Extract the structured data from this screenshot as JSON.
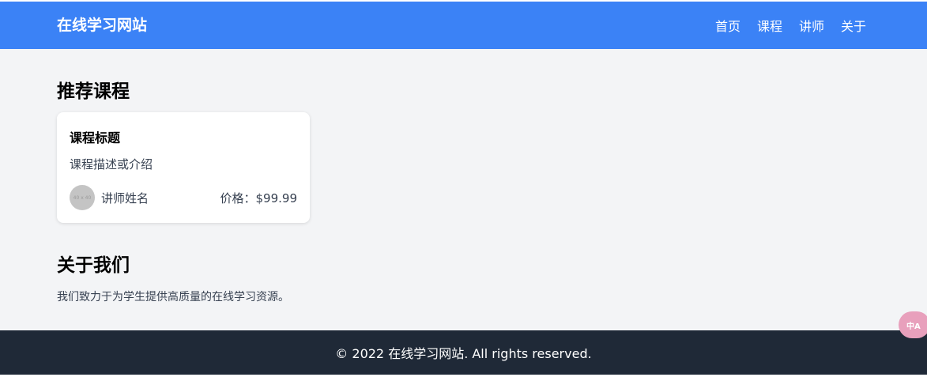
{
  "header": {
    "logo": "在线学习网站",
    "nav": [
      "首页",
      "课程",
      "讲师",
      "关于"
    ]
  },
  "courses": {
    "heading": "推荐课程",
    "card": {
      "title": "课程标题",
      "description": "课程描述或介绍",
      "avatar_placeholder": "40 x 40",
      "teacher": "讲师姓名",
      "price": "价格：$99.99"
    }
  },
  "about": {
    "heading": "关于我们",
    "text": "我们致力于为学生提供高质量的在线学习资源。"
  },
  "footer": {
    "text": "© 2022 在线学习网站. All rights reserved."
  },
  "translate": {
    "label": "中A"
  },
  "colors": {
    "header_bg": "#3b82f6",
    "page_bg": "#f3f4f6",
    "footer_bg": "#1f2937"
  }
}
